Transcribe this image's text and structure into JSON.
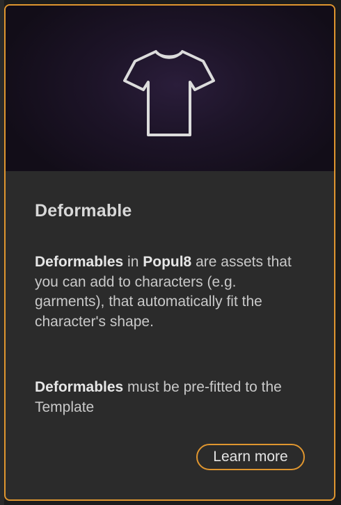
{
  "card": {
    "hero_icon": "t-shirt-icon",
    "title": "Deformable",
    "para1": {
      "term": "Deformables",
      "connector": " in ",
      "brand": "Popul8",
      "rest": " are assets that you can add to characters (e.g. garments), that automatically fit the character's shape."
    },
    "para2": {
      "term": "Deformables",
      "rest": " must be pre-fitted to the Template"
    },
    "learn_more_label": "Learn more"
  },
  "colors": {
    "accent": "#e0962f",
    "card_bg": "#2b2b2b",
    "hero_bg": "#1d1428",
    "text": "#c9c9c9"
  }
}
